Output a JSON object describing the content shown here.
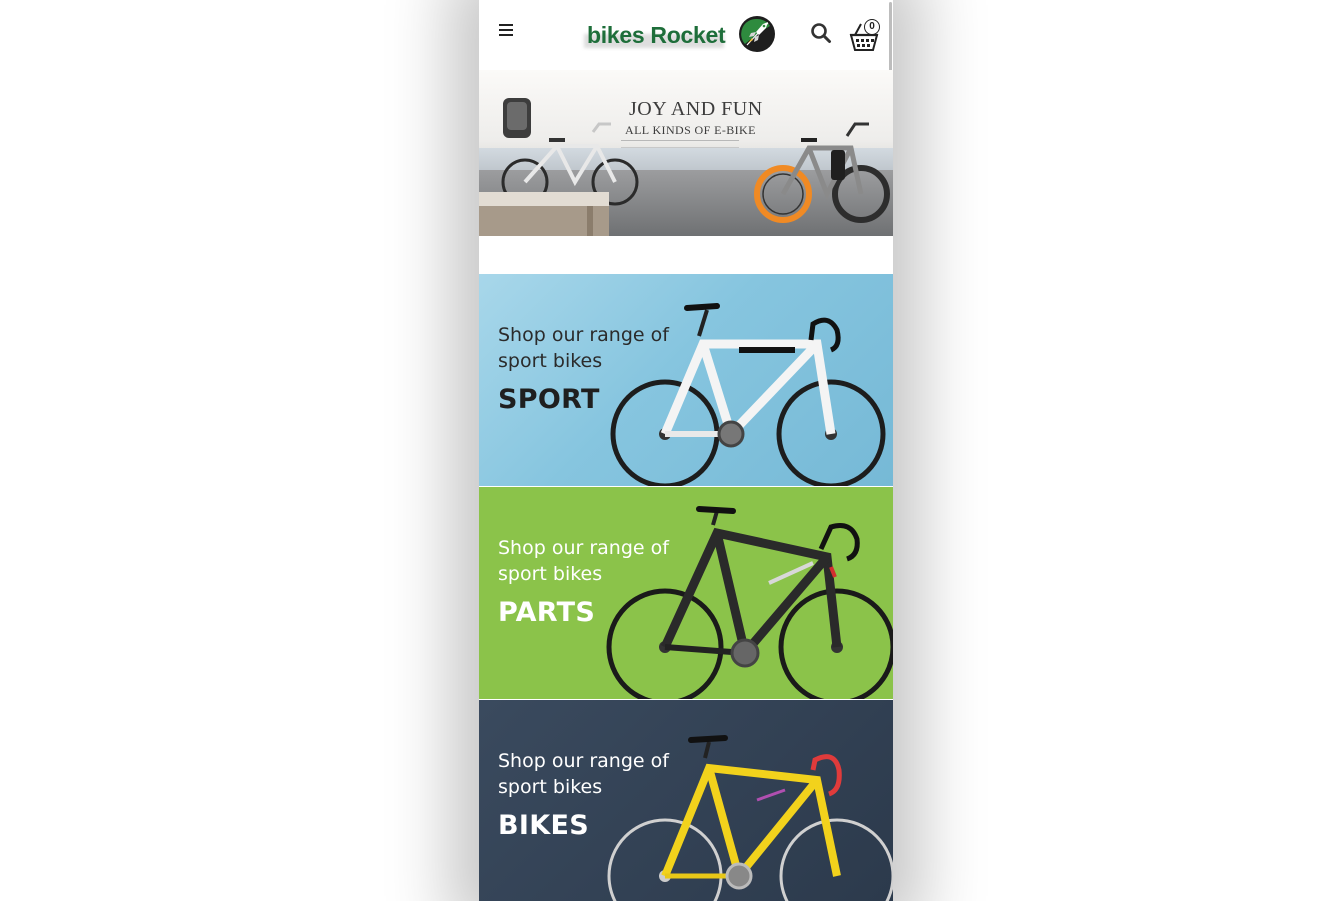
{
  "header": {
    "logo_text": "bikes Rocket",
    "cart_count": "0"
  },
  "hero": {
    "title": "JOY AND FUN",
    "subtitle": "ALL KINDS OF E-BIKE"
  },
  "categories": [
    {
      "line1": "Shop our range of",
      "line2": "sport bikes",
      "title": "SPORT"
    },
    {
      "line1": "Shop our range of",
      "line2": "sport bikes",
      "title": "PARTS"
    },
    {
      "line1": "Shop our range of",
      "line2": "sport bikes",
      "title": "BIKES"
    }
  ],
  "colors": {
    "brand_green": "#1e6e3a",
    "sport_bg": "#86c5df",
    "parts_bg": "#8bc34a",
    "bikes_bg": "#2c3a4c"
  },
  "icons": [
    "menu-icon",
    "search-icon",
    "cart-icon",
    "rocket-logo-icon"
  ]
}
